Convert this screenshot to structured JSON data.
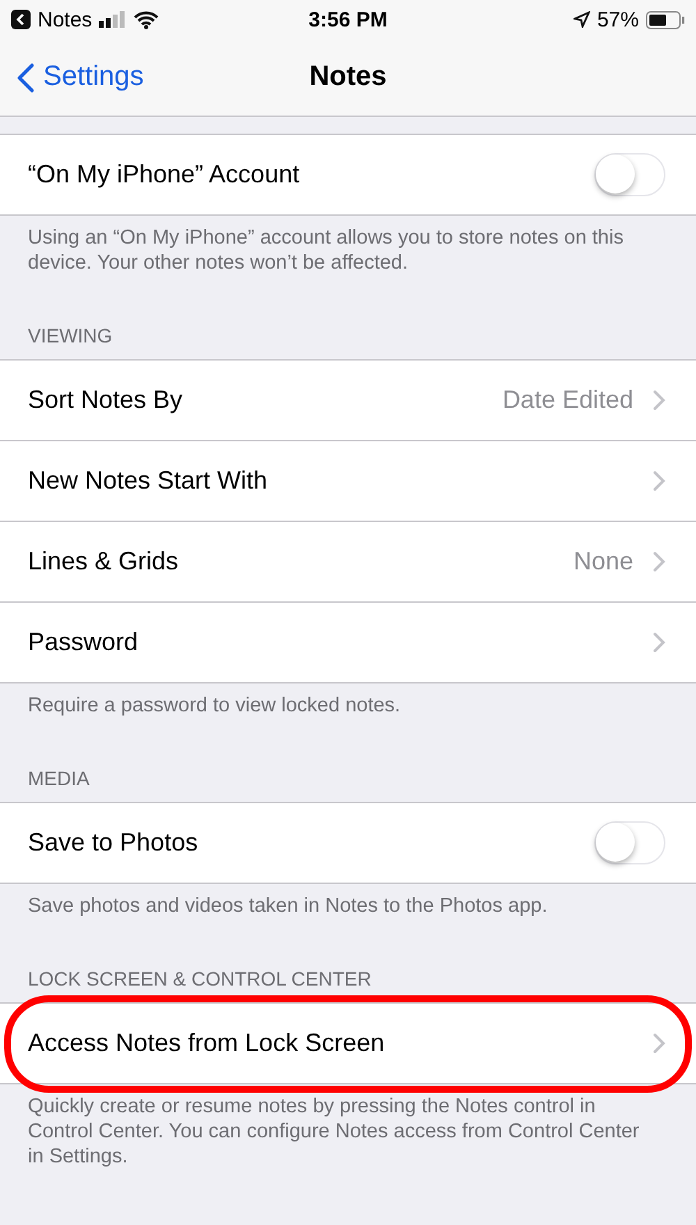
{
  "status_bar": {
    "back_app": "Notes",
    "time": "3:56 PM",
    "battery": "57%"
  },
  "nav": {
    "back": "Settings",
    "title": "Notes"
  },
  "sections": [
    {
      "rows": [
        {
          "kind": "toggle",
          "label": "“On My iPhone” Account",
          "on": false,
          "highlighted": false
        }
      ],
      "footer": "Using an “On My iPhone” account allows you to store notes on this device. Your other notes won’t be affected."
    },
    {
      "header": "VIEWING",
      "rows": [
        {
          "kind": "disclosure",
          "label": "Sort Notes By",
          "value": "Date Edited",
          "highlighted": false
        },
        {
          "kind": "disclosure",
          "label": "New Notes Start With",
          "highlighted": false
        },
        {
          "kind": "disclosure",
          "label": "Lines & Grids",
          "value": "None",
          "highlighted": false
        },
        {
          "kind": "disclosure",
          "label": "Password",
          "highlighted": false
        }
      ],
      "footer": "Require a password to view locked notes."
    },
    {
      "header": "MEDIA",
      "rows": [
        {
          "kind": "toggle",
          "label": "Save to Photos",
          "on": false,
          "highlighted": false
        }
      ],
      "footer": "Save photos and videos taken in Notes to the Photos app."
    },
    {
      "header": "LOCK SCREEN & CONTROL CENTER",
      "rows": [
        {
          "kind": "disclosure",
          "label": "Access Notes from Lock Screen",
          "highlighted": true
        }
      ],
      "footer": "Quickly create or resume notes by pressing the Notes control in Control Center. You can configure Notes access from Control Center in Settings."
    }
  ]
}
